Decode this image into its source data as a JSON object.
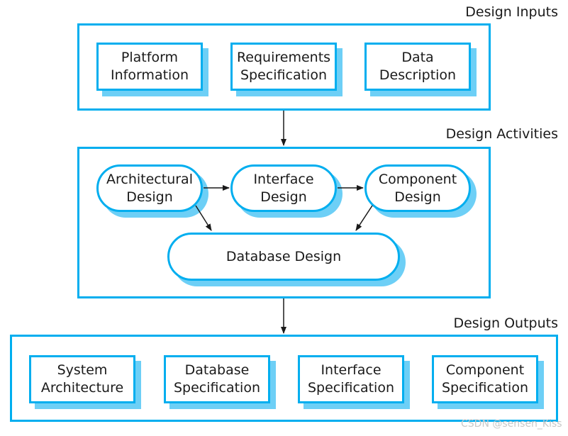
{
  "colors": {
    "border": "#00aeef",
    "shadow": "#6dcff6"
  },
  "inputs": {
    "title": "Design Inputs",
    "items": [
      "Platform\nInformation",
      "Requirements\nSpecification",
      "Data\nDescription"
    ]
  },
  "activities": {
    "title": "Design Activities",
    "items": [
      "Architectural\nDesign",
      "Interface\nDesign",
      "Component\nDesign",
      "Database Design"
    ]
  },
  "outputs": {
    "title": "Design Outputs",
    "items": [
      "System\nArchitecture",
      "Database\nSpecification",
      "Interface\nSpecification",
      "Component\nSpecification"
    ]
  },
  "watermark": "CSDN @sensen_Kiss"
}
